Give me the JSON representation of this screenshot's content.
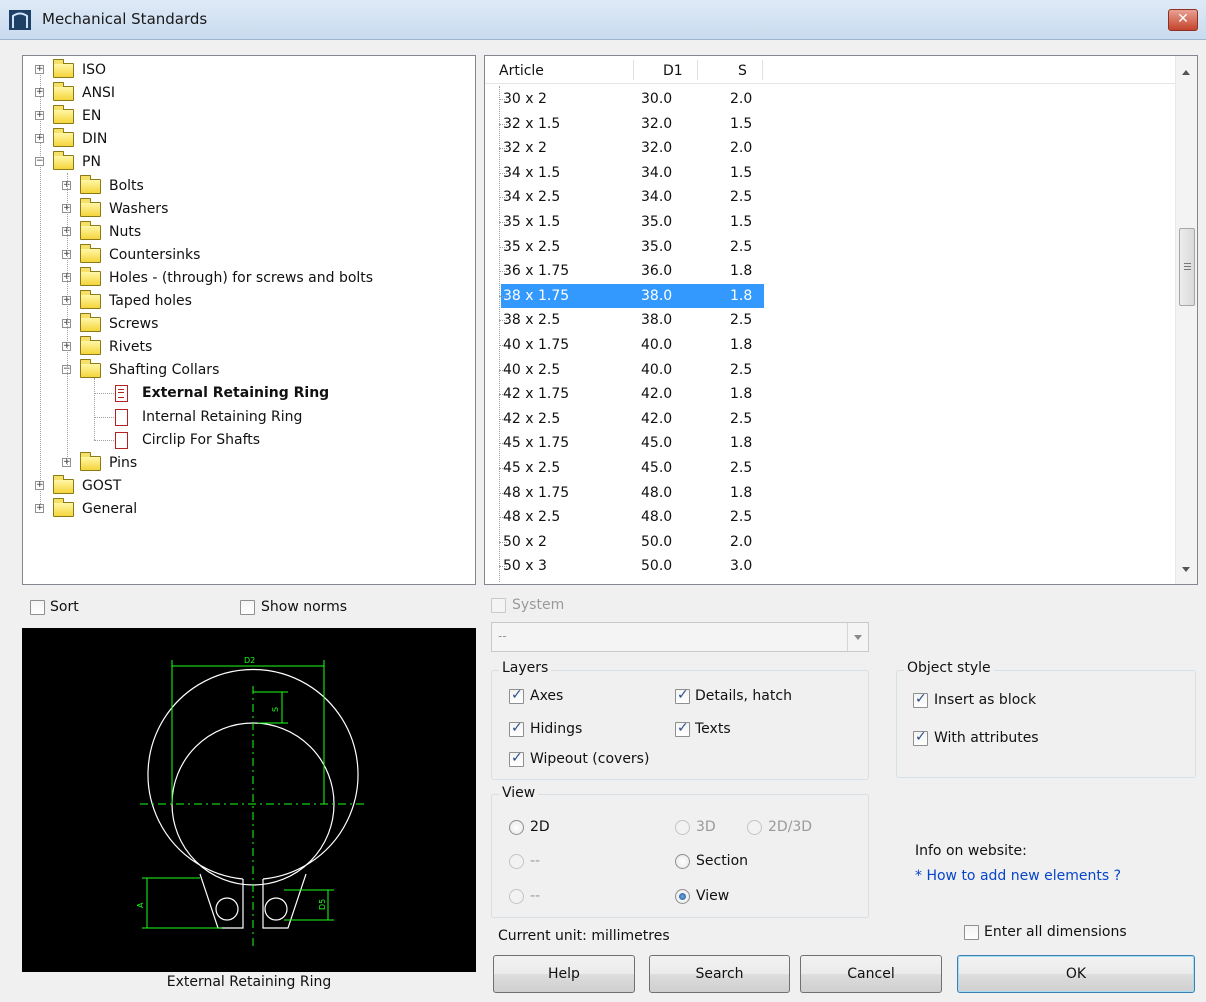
{
  "window": {
    "title": "Mechanical Standards",
    "close_glyph": "✕"
  },
  "tree": {
    "roots": [
      {
        "label": "ISO",
        "expander": "+"
      },
      {
        "label": "ANSI",
        "expander": "+"
      },
      {
        "label": "EN",
        "expander": "+"
      },
      {
        "label": "DIN",
        "expander": "+"
      },
      {
        "label": "PN",
        "expander": "−"
      }
    ],
    "pn_children": [
      {
        "label": "Bolts",
        "expander": "+"
      },
      {
        "label": "Washers",
        "expander": "+"
      },
      {
        "label": "Nuts",
        "expander": "+"
      },
      {
        "label": "Countersinks",
        "expander": "+"
      },
      {
        "label": "Holes - (through) for screws and bolts",
        "expander": "+"
      },
      {
        "label": "Taped holes",
        "expander": "+"
      },
      {
        "label": "Screws",
        "expander": "+"
      },
      {
        "label": "Rivets",
        "expander": "+"
      },
      {
        "label": "Shafting Collars",
        "expander": "−"
      }
    ],
    "shafting_children": [
      {
        "label": "External Retaining Ring"
      },
      {
        "label": "Internal Retaining Ring"
      },
      {
        "label": "Circlip For Shafts"
      }
    ],
    "after": [
      {
        "label": "Pins",
        "expander": "+"
      },
      {
        "label": "GOST",
        "expander": "+"
      },
      {
        "label": "General",
        "expander": "+"
      }
    ]
  },
  "table": {
    "columns": [
      "Article",
      "D1",
      "S"
    ],
    "selected_index": 8,
    "rows": [
      [
        "30 x 2",
        "30.0",
        "2.0"
      ],
      [
        "32 x 1.5",
        "32.0",
        "1.5"
      ],
      [
        "32 x 2",
        "32.0",
        "2.0"
      ],
      [
        "34 x 1.5",
        "34.0",
        "1.5"
      ],
      [
        "34 x 2.5",
        "34.0",
        "2.5"
      ],
      [
        "35 x 1.5",
        "35.0",
        "1.5"
      ],
      [
        "35 x 2.5",
        "35.0",
        "2.5"
      ],
      [
        "36 x 1.75",
        "36.0",
        "1.8"
      ],
      [
        "38 x 1.75",
        "38.0",
        "1.8"
      ],
      [
        "38 x 2.5",
        "38.0",
        "2.5"
      ],
      [
        "40 x 1.75",
        "40.0",
        "1.8"
      ],
      [
        "40 x 2.5",
        "40.0",
        "2.5"
      ],
      [
        "42 x 1.75",
        "42.0",
        "1.8"
      ],
      [
        "42 x 2.5",
        "42.0",
        "2.5"
      ],
      [
        "45 x 1.75",
        "45.0",
        "1.8"
      ],
      [
        "45 x 2.5",
        "45.0",
        "2.5"
      ],
      [
        "48 x 1.75",
        "48.0",
        "1.8"
      ],
      [
        "48 x 2.5",
        "48.0",
        "2.5"
      ],
      [
        "50 x 2",
        "50.0",
        "2.0"
      ],
      [
        "50 x 3",
        "50.0",
        "3.0"
      ]
    ]
  },
  "options": {
    "sort": "Sort",
    "show_norms": "Show norms",
    "system": "System",
    "system_value": "--"
  },
  "preview": {
    "caption": "External Retaining Ring",
    "dim_labels": {
      "d2": "D2",
      "s": "S",
      "a": "A",
      "d5": "D5"
    },
    "line_color": "#ffffff",
    "dimension_color": "#1aff1a"
  },
  "layers": {
    "title": "Layers",
    "axes": "Axes",
    "details_hatch": "Details, hatch",
    "hidings": "Hidings",
    "texts": "Texts",
    "wipeout": "Wipeout (covers)"
  },
  "object_style": {
    "title": "Object style",
    "insert_as_block": "Insert as block",
    "with_attributes": "With attributes"
  },
  "view": {
    "title": "View",
    "opt_2d": "2D",
    "opt_3d": "3D",
    "opt_2d3d": "2D/3D",
    "opt_dash1": "--",
    "opt_section": "Section",
    "opt_dash2": "--",
    "opt_view": "View",
    "selected": "View"
  },
  "info": {
    "label": "Info on website:",
    "link": "* How to add new elements ?"
  },
  "enter_all_dimensions": "Enter all dimensions",
  "unit_text": "Current unit: millimetres",
  "buttons": {
    "help": "Help",
    "search": "Search",
    "cancel": "Cancel",
    "ok": "OK"
  },
  "colors": {
    "selection": "#3399ff",
    "link": "#0645c8",
    "close_button": "#c4432c"
  }
}
